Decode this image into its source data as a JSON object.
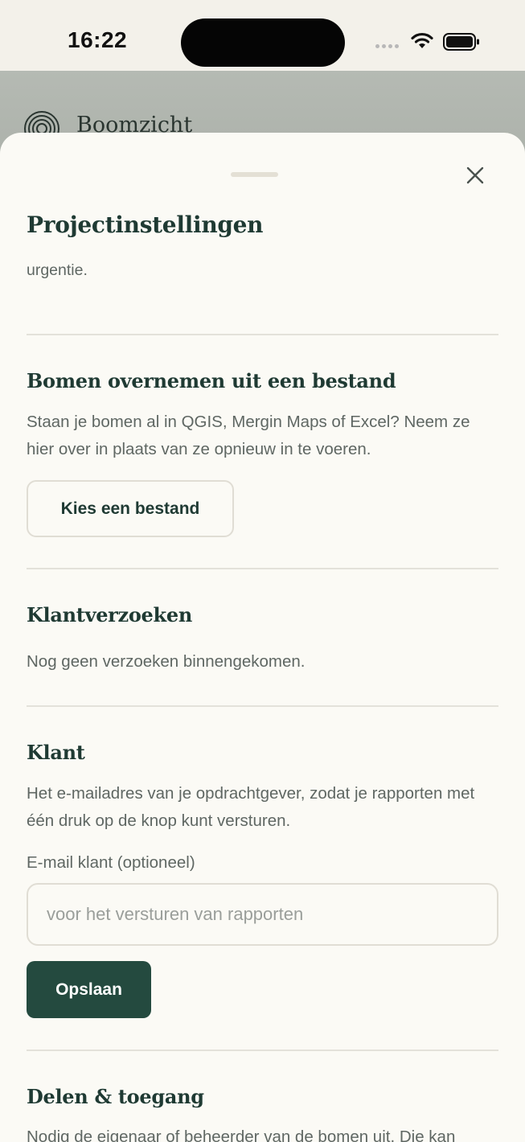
{
  "status_bar": {
    "time": "16:22"
  },
  "background_app": {
    "title": "Boomzicht"
  },
  "sheet": {
    "title": "Projectinstellingen",
    "lead_text": "nodig heeft — net als de gebreken, aantastingen, maatregelen en urgentie.",
    "import_section": {
      "title": "Bomen overnemen uit een bestand",
      "description": "Staan je bomen al in QGIS, Mergin Maps of Excel? Neem ze hier over in plaats van ze opnieuw in te voeren.",
      "button_label": "Kies een bestand"
    },
    "requests_section": {
      "title": "Klantverzoeken",
      "empty_text": "Nog geen verzoeken binnengekomen."
    },
    "client_section": {
      "title": "Klant",
      "description": "Het e-mailadres van je opdrachtgever, zodat je rapporten met één druk op de knop kunt versturen.",
      "email_label": "E-mail klant (optioneel)",
      "email_value": "",
      "email_placeholder": "voor het versturen van rapporten",
      "save_label": "Opslaan"
    },
    "share_section": {
      "title": "Delen & toegang",
      "description": "Nodig de eigenaar of beheerder van de bomen uit. Die kan"
    }
  },
  "icons": {
    "close": "close-icon",
    "logo": "tree-rings-logo-icon",
    "wifi": "wifi-icon",
    "battery": "battery-icon",
    "signal": "signal-icon"
  },
  "colors": {
    "primary": "#244a3f",
    "heading": "#1f3a33",
    "body_text": "#5f6763",
    "sheet_bg": "#fbfaf5",
    "border": "#e0ddd4"
  }
}
